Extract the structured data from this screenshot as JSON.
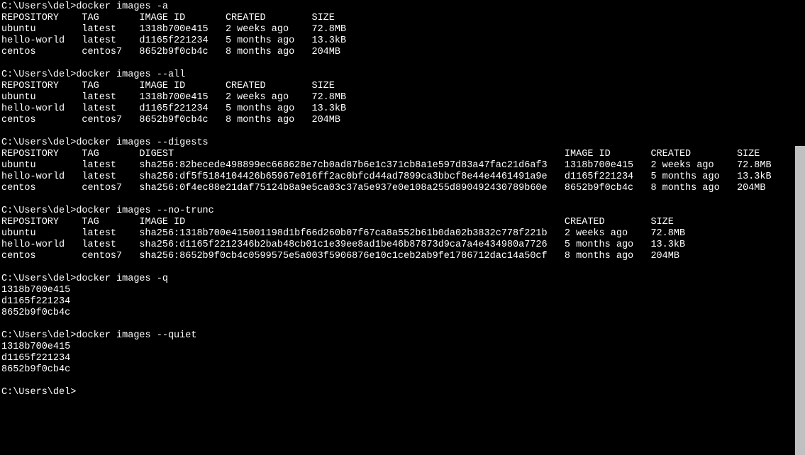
{
  "prompt": "C:\\Users\\del>",
  "blocks": [
    {
      "command": "docker images -a",
      "headers": [
        "REPOSITORY",
        "TAG",
        "IMAGE ID",
        "CREATED",
        "SIZE"
      ],
      "rows": [
        [
          "ubuntu",
          "latest",
          "1318b700e415",
          "2 weeks ago",
          "72.8MB"
        ],
        [
          "hello-world",
          "latest",
          "d1165f221234",
          "5 months ago",
          "13.3kB"
        ],
        [
          "centos",
          "centos7",
          "8652b9f0cb4c",
          "8 months ago",
          "204MB"
        ]
      ]
    },
    {
      "command": "docker images --all",
      "headers": [
        "REPOSITORY",
        "TAG",
        "IMAGE ID",
        "CREATED",
        "SIZE"
      ],
      "rows": [
        [
          "ubuntu",
          "latest",
          "1318b700e415",
          "2 weeks ago",
          "72.8MB"
        ],
        [
          "hello-world",
          "latest",
          "d1165f221234",
          "5 months ago",
          "13.3kB"
        ],
        [
          "centos",
          "centos7",
          "8652b9f0cb4c",
          "8 months ago",
          "204MB"
        ]
      ]
    },
    {
      "command": "docker images --digests",
      "wrapped": true,
      "headers": [
        "REPOSITORY",
        "TAG",
        "DIGEST",
        "IMAGE ID",
        "CREATED",
        "SIZE"
      ],
      "rows": [
        [
          "ubuntu",
          "latest",
          "sha256:82becede498899ec668628e7cb0ad87b6e1c371cb8a1e597d83a47fac21d6af3",
          "1318b700e415",
          "2 weeks ago",
          "72.8MB"
        ],
        [
          "hello-world",
          "latest",
          "sha256:df5f5184104426b65967e016ff2ac0bfcd44ad7899ca3bbcf8e44e4461491a9e",
          "d1165f221234",
          "5 months ago",
          "13.3kB"
        ],
        [
          "centos",
          "centos7",
          "sha256:0f4ec88e21daf75124b8a9e5ca03c37a5e937e0e108a255d890492430789b60e",
          "8652b9f0cb4c",
          "8 months ago",
          "204MB"
        ]
      ]
    },
    {
      "command": "docker images --no-trunc",
      "headers": [
        "REPOSITORY",
        "TAG",
        "IMAGE ID",
        "CREATED",
        "SIZE"
      ],
      "rows": [
        [
          "ubuntu",
          "latest",
          "sha256:1318b700e415001198d1bf66d260b07f67ca8a552b61b0da02b3832c778f221b",
          "2 weeks ago",
          "72.8MB"
        ],
        [
          "hello-world",
          "latest",
          "sha256:d1165f2212346b2bab48cb01c1e39ee8ad1be46b87873d9ca7a4e434980a7726",
          "5 months ago",
          "13.3kB"
        ],
        [
          "centos",
          "centos7",
          "sha256:8652b9f0cb4c0599575e5a003f5906876e10c1ceb2ab9fe1786712dac14a50cf",
          "8 months ago",
          "204MB"
        ]
      ]
    },
    {
      "command": "docker images -q",
      "lines": [
        "1318b700e415",
        "d1165f221234",
        "8652b9f0cb4c"
      ]
    },
    {
      "command": "docker images --quiet",
      "lines": [
        "1318b700e415",
        "d1165f221234",
        "8652b9f0cb4c"
      ]
    }
  ],
  "final_prompt": "C:\\Users\\del>"
}
